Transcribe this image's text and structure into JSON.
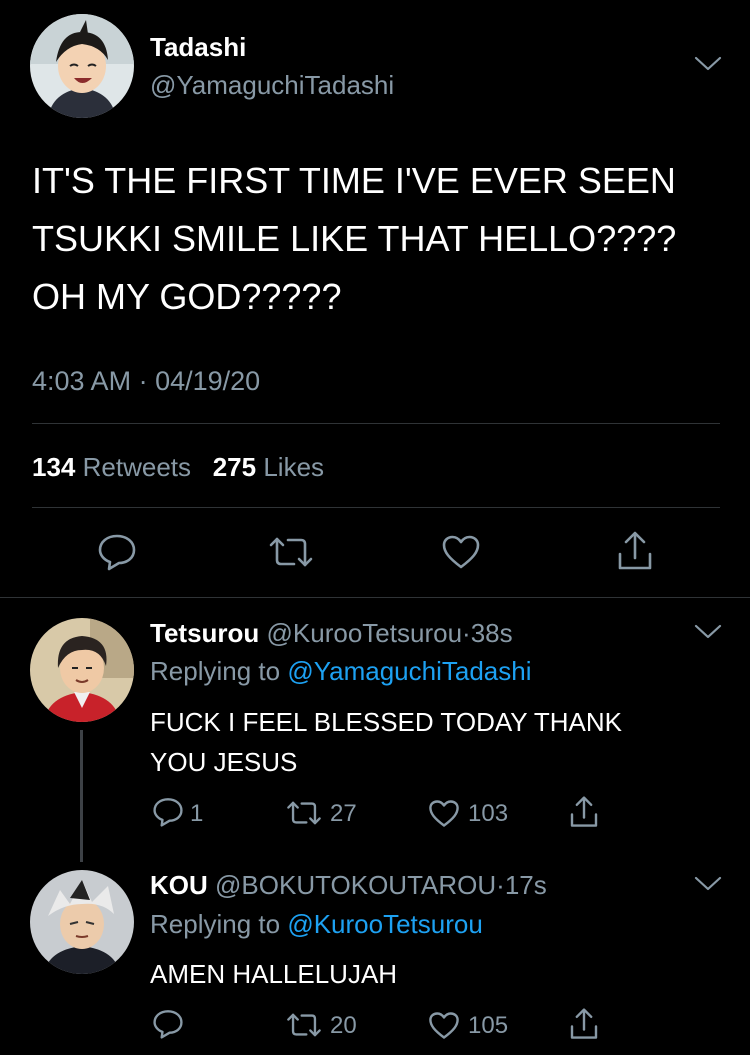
{
  "tweet": {
    "display_name": "Tadashi",
    "handle": "@YamaguchiTadashi",
    "text_lines": [
      "IT'S THE FIRST TIME I'VE EVER SEEN",
      "TSUKKI SMILE LIKE THAT HELLO????",
      "OH MY GOD?????"
    ],
    "time": "4:03 AM",
    "sep": "·",
    "date": "04/19/20",
    "retweets_count": "134",
    "retweets_label": "Retweets",
    "likes_count": "275",
    "likes_label": "Likes"
  },
  "replies": [
    {
      "display_name": "Tetsurou",
      "handle": "@KurooTetsurou",
      "sep": "·",
      "age": "38s",
      "replying_prefix": "Replying to",
      "replying_to": "@YamaguchiTadashi",
      "text_lines": [
        "FUCK I FEEL BLESSED TODAY THANK",
        "YOU JESUS"
      ],
      "reply_count": "1",
      "retweet_count": "27",
      "like_count": "103"
    },
    {
      "display_name": "KOU",
      "handle": "@BOKUTOKOUTAROU",
      "sep": "·",
      "age": "17s",
      "replying_prefix": "Replying to",
      "replying_to": "@KurooTetsurou",
      "text_lines": [
        "AMEN HALLELUJAH"
      ],
      "reply_count": "",
      "retweet_count": "20",
      "like_count": "105"
    }
  ],
  "colors": {
    "background": "#000000",
    "muted": "#8899a6",
    "link": "#1da1f2",
    "divider": "#2f3336"
  },
  "icons": [
    "reply-icon",
    "retweet-icon",
    "like-icon",
    "share-icon",
    "chevron-down-icon"
  ]
}
